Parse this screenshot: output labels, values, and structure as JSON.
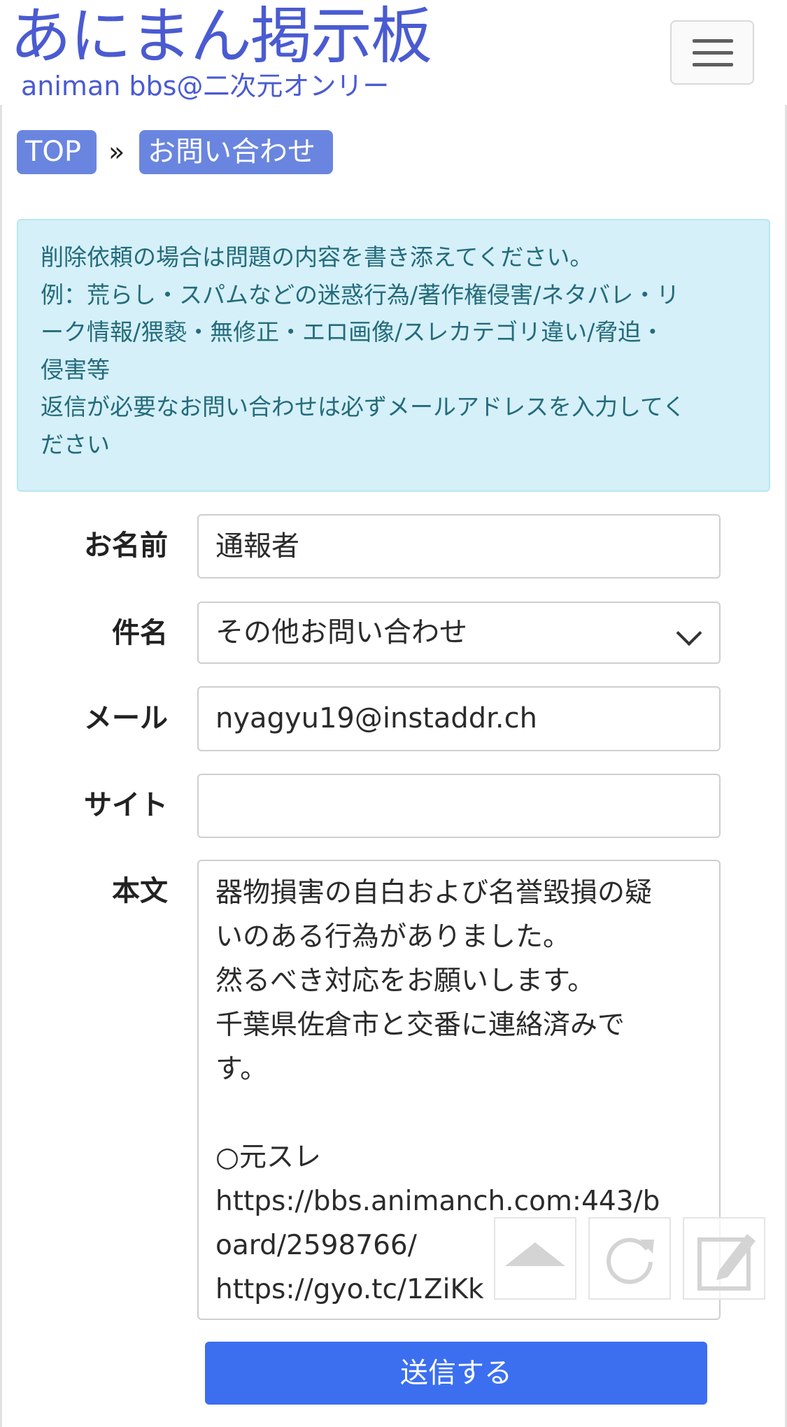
{
  "header": {
    "logo_title": "あにまん掲示板",
    "logo_subtitle": "animan bbs@二次元オンリー"
  },
  "breadcrumb": {
    "top": "TOP",
    "separator": "»",
    "current": "お問い合わせ"
  },
  "alert": {
    "lines": [
      "削除依頼の場合は問題の内容を書き添えてください。",
      "例：荒らし・スパムなどの迷惑行為/著作権侵害/ネタバレ・リ",
      "ーク情報/猥褻・無修正・エロ画像/スレカテゴリ違い/脅迫・",
      "侵害等",
      "返信が必要なお問い合わせは必ずメールアドレスを入力してく",
      "ださい"
    ]
  },
  "form": {
    "name_label": "お名前",
    "name_value": "通報者",
    "subject_label": "件名",
    "subject_value": "その他お問い合わせ",
    "mail_label": "メール",
    "mail_value": "nyagyu19@instaddr.ch",
    "site_label": "サイト",
    "site_value": "",
    "body_label": "本文",
    "body_lines": [
      "器物損害の自白および名誉毀損の疑",
      "いのある行為がありました。",
      "然るべき対応をお願いします。",
      "千葉県佐倉市と交番に連絡済みで",
      "す。",
      "",
      "○元スレ",
      "https://bbs.animanch.com:443/b",
      "oard/2598766/",
      "https://gyo.tc/1ZiKk"
    ],
    "submit_label": "送信する"
  },
  "colors": {
    "brand": "#4a5bd1",
    "crumb": "#6a85df",
    "alert_bg": "#d5f0f8",
    "alert_text": "#246b7c",
    "submit": "#3b6ff0"
  }
}
